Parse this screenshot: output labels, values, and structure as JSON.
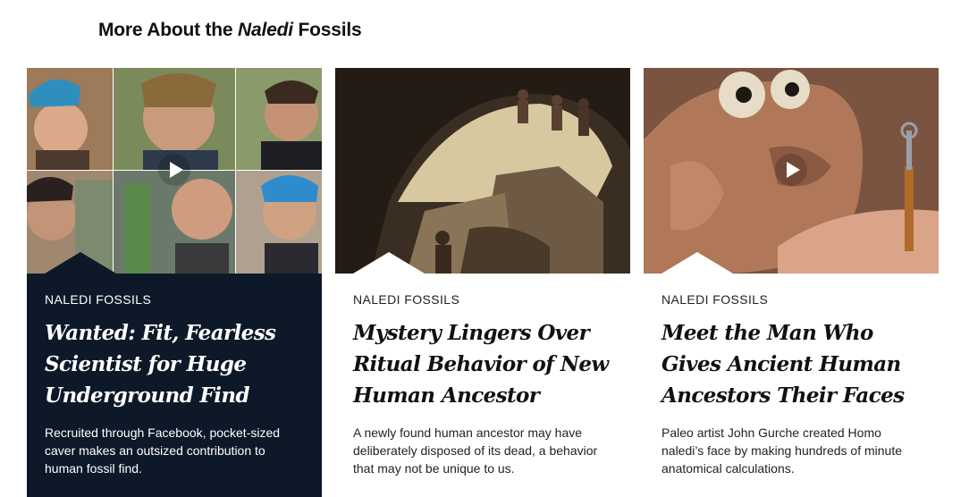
{
  "section": {
    "title_prefix": "More About the ",
    "title_italic": "Naledi",
    "title_suffix": " Fossils"
  },
  "cards": [
    {
      "kicker": "NALEDI FOSSILS",
      "headline": "Wanted: Fit, Fearless Scientist for Huge Underground Find",
      "dek": "Recruited through Facebook, pocket-sized caver makes an outsized contribution to human fossil find.",
      "thumb_icon": "photo-collage-icon",
      "has_video": true
    },
    {
      "kicker": "NALEDI FOSSILS",
      "headline": "Mystery Lingers Over Ritual Behavior of New Human Ancestor",
      "dek": "A newly found human ancestor may have deliberately disposed of its dead, a behavior that may not be unique to us.",
      "thumb_icon": "cave-painting-icon",
      "has_video": false
    },
    {
      "kicker": "NALEDI FOSSILS",
      "headline": "Meet the Man Who Gives Ancient Human Ancestors Their Faces",
      "dek": "Paleo artist John Gurche created Homo naledi’s face by making hundreds of minute anatomical calculations.",
      "thumb_icon": "clay-sculpture-icon",
      "has_video": true
    }
  ],
  "colors": {
    "dark_card": "#0d1929",
    "text": "#111111"
  }
}
